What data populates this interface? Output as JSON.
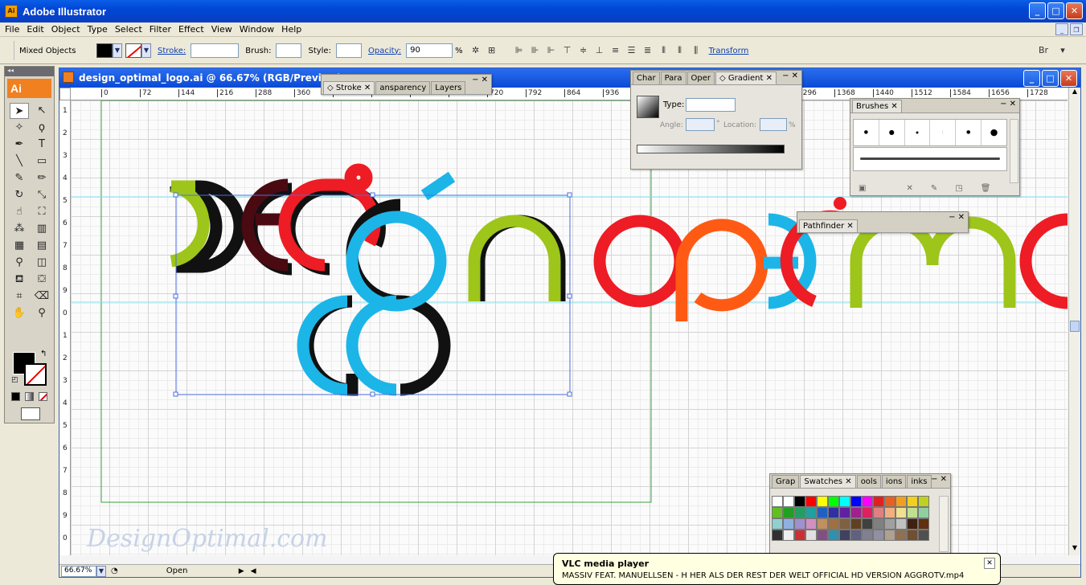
{
  "app": {
    "title": "Adobe Illustrator",
    "icon": "ai-app-icon"
  },
  "menu": [
    "File",
    "Edit",
    "Object",
    "Type",
    "Select",
    "Filter",
    "Effect",
    "View",
    "Window",
    "Help"
  ],
  "control": {
    "selection": "Mixed Objects",
    "stroke_label": "Stroke:",
    "brush_label": "Brush:",
    "style_label": "Style:",
    "opacity_label": "Opacity:",
    "opacity_value": "90",
    "percent": "%",
    "transform_label": "Transform"
  },
  "tools": {
    "logo": "Ai"
  },
  "document": {
    "title": "design_optimal_logo.ai @ 66.67% (RGB/Preview)",
    "zoom": "66.67%",
    "status": "Open"
  },
  "hruler": [
    "0",
    "72",
    "144",
    "216",
    "288",
    "360",
    "432",
    "504",
    "576",
    "648",
    "720",
    "792",
    "864",
    "936",
    "1008",
    "1080",
    "1152",
    "1224",
    "1296",
    "1368",
    "1440",
    "1512",
    "1584",
    "1656",
    "1728"
  ],
  "vruler": [
    "1",
    "2",
    "3",
    "4",
    "5",
    "6",
    "7",
    "8",
    "9",
    "0",
    "1",
    "2",
    "3",
    "4",
    "5",
    "6",
    "7",
    "8",
    "9",
    "0"
  ],
  "panels": {
    "stroke": {
      "tabs": [
        "Stroke",
        "ansparency",
        "Layers"
      ]
    },
    "gradient": {
      "tabs": [
        "Char",
        "Para",
        "Oper",
        "Gradient"
      ],
      "type_label": "Type:",
      "angle_label": "Angle:",
      "degree": "°",
      "location_label": "Location:",
      "percent": "%"
    },
    "brushes": {
      "tab": "Brushes"
    },
    "pathfinder": {
      "tab": "Pathfinder"
    },
    "swatches": {
      "tabs": [
        "Grap",
        "Swatches",
        "ools",
        "ions",
        "inks"
      ]
    }
  },
  "watermark": "DesignOptimal.com",
  "vlc": {
    "title": "VLC media player",
    "text": "MASSIV FEAT. MANUELLSEN - H HER ALS DER REST DER WELT OFFICIAL HD VERSION AGGROTV.mp4"
  },
  "colors": {
    "black": "#000000",
    "lime": "#9dc51a",
    "maroon": "#4a0a12",
    "red": "#ee1c24",
    "cyan": "#1cb5e8",
    "orange": "#ff5a14"
  }
}
